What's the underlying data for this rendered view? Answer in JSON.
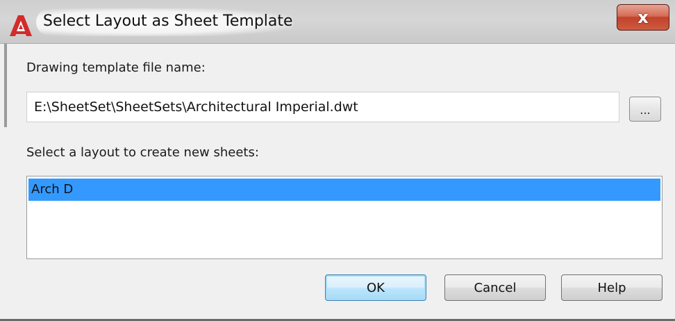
{
  "window": {
    "title": "Select Layout as Sheet Template",
    "close_label": "x"
  },
  "template": {
    "label": "Drawing template file name:",
    "path": "E:\\SheetSet\\SheetSets\\Architectural Imperial.dwt",
    "browse_label": "..."
  },
  "layouts": {
    "label": "Select a layout to create new sheets:",
    "items": [
      "Arch D"
    ],
    "selected": "Arch D"
  },
  "buttons": {
    "ok": "OK",
    "cancel": "Cancel",
    "help": "Help"
  },
  "icons": {
    "app": "autocad-icon",
    "close": "close-icon"
  },
  "colors": {
    "selection": "#3399ff",
    "close_button": "#c2422a",
    "app_icon": "#d22b2b"
  }
}
